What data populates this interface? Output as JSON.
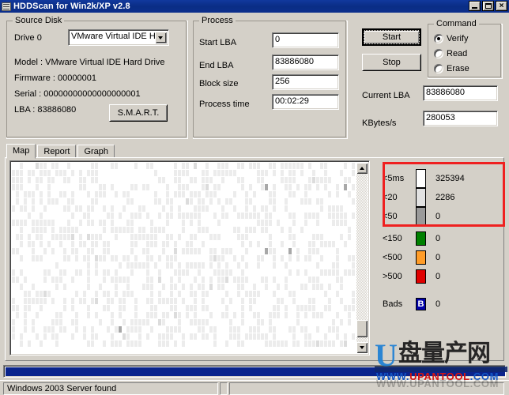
{
  "window": {
    "title": "HDDScan for Win2k/XP  v2.8",
    "icon": "window-icon",
    "minimize_label": "",
    "maximize_label": "",
    "close_label": "×"
  },
  "source_disk": {
    "group_title": "Source Disk",
    "drive_label": "Drive  0",
    "drive_value": "VMware Virtual IDE H",
    "model": "Model : VMware Virtual IDE Hard Drive",
    "firmware": "Firmware : 00000001",
    "serial": "Serial : 00000000000000000001",
    "lba": "LBA :  83886080",
    "smart_button": "S.M.A.R.T."
  },
  "process": {
    "group_title": "Process",
    "fields": [
      {
        "label": "Start LBA",
        "value": "0"
      },
      {
        "label": "End LBA",
        "value": "83886080"
      },
      {
        "label": "Block size",
        "value": "256"
      },
      {
        "label": "Process time",
        "value": "00:02:29"
      }
    ]
  },
  "controls": {
    "start_button": "Start",
    "stop_button": "Stop",
    "current_lba_label": "Current LBA",
    "current_lba_value": "83886080",
    "kbytes_label": "KBytes/s",
    "kbytes_value": "280053"
  },
  "command": {
    "group_title": "Command",
    "options": [
      {
        "label": "Verify",
        "selected": true
      },
      {
        "label": "Read",
        "selected": false
      },
      {
        "label": "Erase",
        "selected": false
      }
    ]
  },
  "tabs": [
    {
      "label": "Map",
      "active": true
    },
    {
      "label": "Report",
      "active": false
    },
    {
      "label": "Graph",
      "active": false
    }
  ],
  "legend": {
    "highlight_color": "#ef2020",
    "rows": [
      {
        "label": "<5ms",
        "color": "#ffffff",
        "count": "325394"
      },
      {
        "label": "<20",
        "color": "#e2e2e2",
        "count": "2286"
      },
      {
        "label": "<50",
        "color": "#9a9a9a",
        "count": "0"
      },
      {
        "label": "<150",
        "color": "#008000",
        "count": "0"
      },
      {
        "label": "<500",
        "color": "#ff9c28",
        "count": "0"
      },
      {
        "label": ">500",
        "color": "#e00000",
        "count": "0"
      }
    ],
    "bads_label": "Bads",
    "bads_badge": "B",
    "bads_count": "0"
  },
  "scrollbar": {
    "up_arrow": "scroll-up-arrow",
    "down_arrow": "scroll-down-arrow"
  },
  "progress": {
    "percent": 100
  },
  "status": {
    "message": "Windows 2003 Server found"
  },
  "watermark": {
    "logo_letter": "U",
    "logo_cn": "盘量产网",
    "url_prefix": "WWW.",
    "url_mid": "UPANTOOL",
    "url_suffix": ".COM"
  }
}
